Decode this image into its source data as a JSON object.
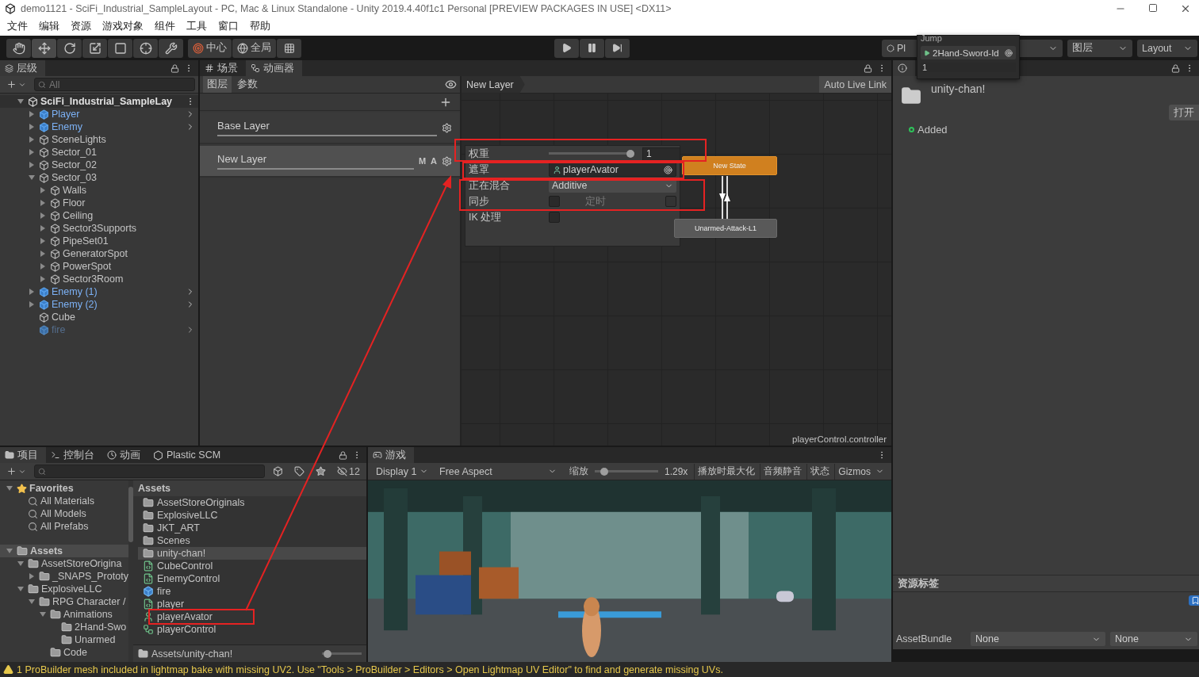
{
  "window": {
    "title": "demo1121 - SciFi_Industrial_SampleLayout - PC, Mac & Linux Standalone - Unity 2019.4.40f1c1 Personal [PREVIEW PACKAGES IN USE] <DX11>"
  },
  "menu": [
    "文件",
    "编辑",
    "资源",
    "游戏对象",
    "组件",
    "工具",
    "窗口",
    "帮助"
  ],
  "toolbar": {
    "tools": [
      {
        "kind": "hand",
        "selected": false
      },
      {
        "kind": "move",
        "selected": true
      },
      {
        "kind": "rotate",
        "selected": false
      },
      {
        "kind": "scale",
        "selected": false
      },
      {
        "kind": "rect",
        "selected": false
      },
      {
        "kind": "transform",
        "selected": false
      },
      {
        "kind": "custom",
        "selected": false
      }
    ],
    "pivot": "中心",
    "space": "全局",
    "playback": [
      {
        "kind": "play",
        "selected": false
      },
      {
        "kind": "pause",
        "selected": false
      },
      {
        "kind": "step",
        "selected": false
      }
    ],
    "collab": "Pl",
    "layers": "图层",
    "layout": "Layout"
  },
  "popup": {
    "title": "Jump",
    "field": "2Hand-Sword-Id",
    "value": "1"
  },
  "hierarchy": {
    "tab": "层级",
    "search": {
      "placeholder": "All"
    },
    "scene": {
      "label": "SciFi_Industrial_SampleLay",
      "kind": "scene",
      "expanded": true,
      "disabled": false,
      "children": [
        {
          "label": "Player",
          "kind": "prefab",
          "expanded": false,
          "disabled": false
        },
        {
          "label": "Enemy",
          "kind": "prefab",
          "expanded": false,
          "disabled": false
        },
        {
          "label": "SceneLights",
          "kind": "object",
          "expanded": false,
          "disabled": false
        },
        {
          "label": "Sector_01",
          "kind": "object",
          "expanded": false,
          "disabled": false
        },
        {
          "label": "Sector_02",
          "kind": "object",
          "expanded": false,
          "disabled": false
        },
        {
          "label": "Sector_03",
          "kind": "object",
          "expanded": true,
          "disabled": false,
          "children": [
            {
              "label": "Walls",
              "kind": "object",
              "expanded": false,
              "disabled": false
            },
            {
              "label": "Floor",
              "kind": "object",
              "expanded": false,
              "disabled": false
            },
            {
              "label": "Ceiling",
              "kind": "object",
              "expanded": false,
              "disabled": false
            },
            {
              "label": "Sector3Supports",
              "kind": "object",
              "expanded": false,
              "disabled": false
            },
            {
              "label": "PipeSet01",
              "kind": "object",
              "expanded": false,
              "disabled": false
            },
            {
              "label": "GeneratorSpot",
              "kind": "object",
              "expanded": false,
              "disabled": false
            },
            {
              "label": "PowerSpot",
              "kind": "object",
              "expanded": false,
              "disabled": false
            },
            {
              "label": "Sector3Room",
              "kind": "object",
              "expanded": false,
              "disabled": false
            }
          ]
        },
        {
          "label": "Enemy (1)",
          "kind": "prefab",
          "expanded": false,
          "disabled": false
        },
        {
          "label": "Enemy (2)",
          "kind": "prefab",
          "expanded": false,
          "disabled": false
        },
        {
          "label": "Cube",
          "kind": "object",
          "disabled": false
        },
        {
          "label": "fire",
          "kind": "prefab",
          "disabled": true
        }
      ]
    }
  },
  "animator": {
    "tabs": [
      {
        "label": "场景",
        "kind": "scene",
        "selected": false
      },
      {
        "label": "动画器",
        "kind": "animator",
        "selected": true
      }
    ],
    "panel_tabs": [
      {
        "label": "图层",
        "selected": true
      },
      {
        "label": "参数",
        "selected": false
      }
    ],
    "layers": [
      {
        "name": "Base Layer",
        "selected": false
      },
      {
        "name": "New Layer",
        "selected": true,
        "badges": [
          "M",
          "A"
        ]
      }
    ],
    "breadcrumb": "New Layer",
    "live_link": "Auto Live Link",
    "file": "playerControl.controller",
    "settings": {
      "weight": {
        "label": "权重",
        "level": 1,
        "value": "1"
      },
      "mask": {
        "label": "遮罩",
        "value": "playerAvator"
      },
      "blending": {
        "label": "正在混合",
        "value": "Additive"
      },
      "sync": {
        "label": "同步",
        "checked": false
      },
      "timing": {
        "label": "定时",
        "checked": false,
        "disabled": true
      },
      "ik": {
        "label": "IK 处理",
        "checked": false
      }
    },
    "states": [
      {
        "name": "New State",
        "kind": "default"
      },
      {
        "name": "Unarmed-Attack-L1",
        "kind": "normal"
      }
    ]
  },
  "project": {
    "tabs": [
      {
        "label": "项目",
        "kind": "folder",
        "selected": true
      },
      {
        "label": "控制台",
        "kind": "console",
        "selected": false
      },
      {
        "label": "动画",
        "kind": "clock",
        "selected": false
      },
      {
        "label": "Plastic SCM",
        "kind": "plastic",
        "selected": false
      }
    ],
    "hidden_count": "12",
    "tree": [
      {
        "label": "Favorites",
        "kind": "star",
        "expanded": true,
        "selected": false,
        "children": [
          {
            "label": "All Materials",
            "kind": "search",
            "selected": false
          },
          {
            "label": "All Models",
            "kind": "search",
            "selected": false
          },
          {
            "label": "All Prefabs",
            "kind": "search",
            "selected": false
          }
        ]
      },
      {
        "label": "Assets",
        "kind": "folder",
        "expanded": true,
        "selected": true,
        "children": [
          {
            "label": "AssetStoreOrigina",
            "kind": "folder",
            "expanded": true,
            "selected": false,
            "children": [
              {
                "label": "_SNAPS_Prototy",
                "kind": "folder",
                "expanded": false,
                "selected": false
              }
            ]
          },
          {
            "label": "ExplosiveLLC",
            "kind": "folder",
            "expanded": true,
            "selected": false,
            "children": [
              {
                "label": "RPG Character /",
                "kind": "folder",
                "expanded": true,
                "selected": false,
                "children": [
                  {
                    "label": "Animations",
                    "kind": "folder",
                    "expanded": true,
                    "selected": false,
                    "children": [
                      {
                        "label": "2Hand-Swo",
                        "kind": "folder",
                        "selected": false
                      },
                      {
                        "label": "Unarmed",
                        "kind": "folder",
                        "selected": false
                      }
                    ]
                  },
                  {
                    "label": "Code",
                    "kind": "folder",
                    "selected": false
                  }
                ]
              }
            ]
          }
        ]
      }
    ],
    "breadcrumb": "Assets",
    "files": [
      {
        "label": "AssetStoreOriginals",
        "kind": "folder",
        "selected": false
      },
      {
        "label": "ExplosiveLLC",
        "kind": "folder",
        "selected": false
      },
      {
        "label": "JKT_ART",
        "kind": "folder",
        "selected": false
      },
      {
        "label": "Scenes",
        "kind": "folder",
        "selected": false
      },
      {
        "label": "unity-chan!",
        "kind": "folder",
        "selected": true
      },
      {
        "label": "CubeControl",
        "kind": "script",
        "selected": false
      },
      {
        "label": "EnemyControl",
        "kind": "script",
        "selected": false
      },
      {
        "label": "fire",
        "kind": "prefab",
        "selected": false
      },
      {
        "label": "player",
        "kind": "script",
        "selected": false
      },
      {
        "label": "playerAvator",
        "kind": "mask",
        "selected": false
      },
      {
        "label": "playerControl",
        "kind": "controller",
        "selected": false
      }
    ],
    "path": "Assets/unity-chan!",
    "icon_size": {
      "level": 0.05
    }
  },
  "game": {
    "tab": "游戏",
    "display": "Display 1",
    "aspect": "Free Aspect",
    "scale": {
      "label": "缩放",
      "level": 0.1,
      "value": "1.29x"
    },
    "toggles": [
      {
        "label": "播放时最大化",
        "on": false
      },
      {
        "label": "音频静音",
        "on": false
      },
      {
        "label": "状态",
        "on": false
      }
    ],
    "gizmos": "Gizmos"
  },
  "inspector": {
    "name": "unity-chan!",
    "open": "打开",
    "status": "Added",
    "labels_title": "资源标签",
    "bundle": {
      "label": "AssetBundle",
      "value": "None",
      "variant": "None"
    }
  },
  "status_bar": {
    "kind": "warning",
    "message": "1 ProBuilder mesh included in lightmap bake with missing UV2. Use \"Tools > ProBuilder > Editors > Open Lightmap UV Editor\" to find and generate missing UVs."
  }
}
